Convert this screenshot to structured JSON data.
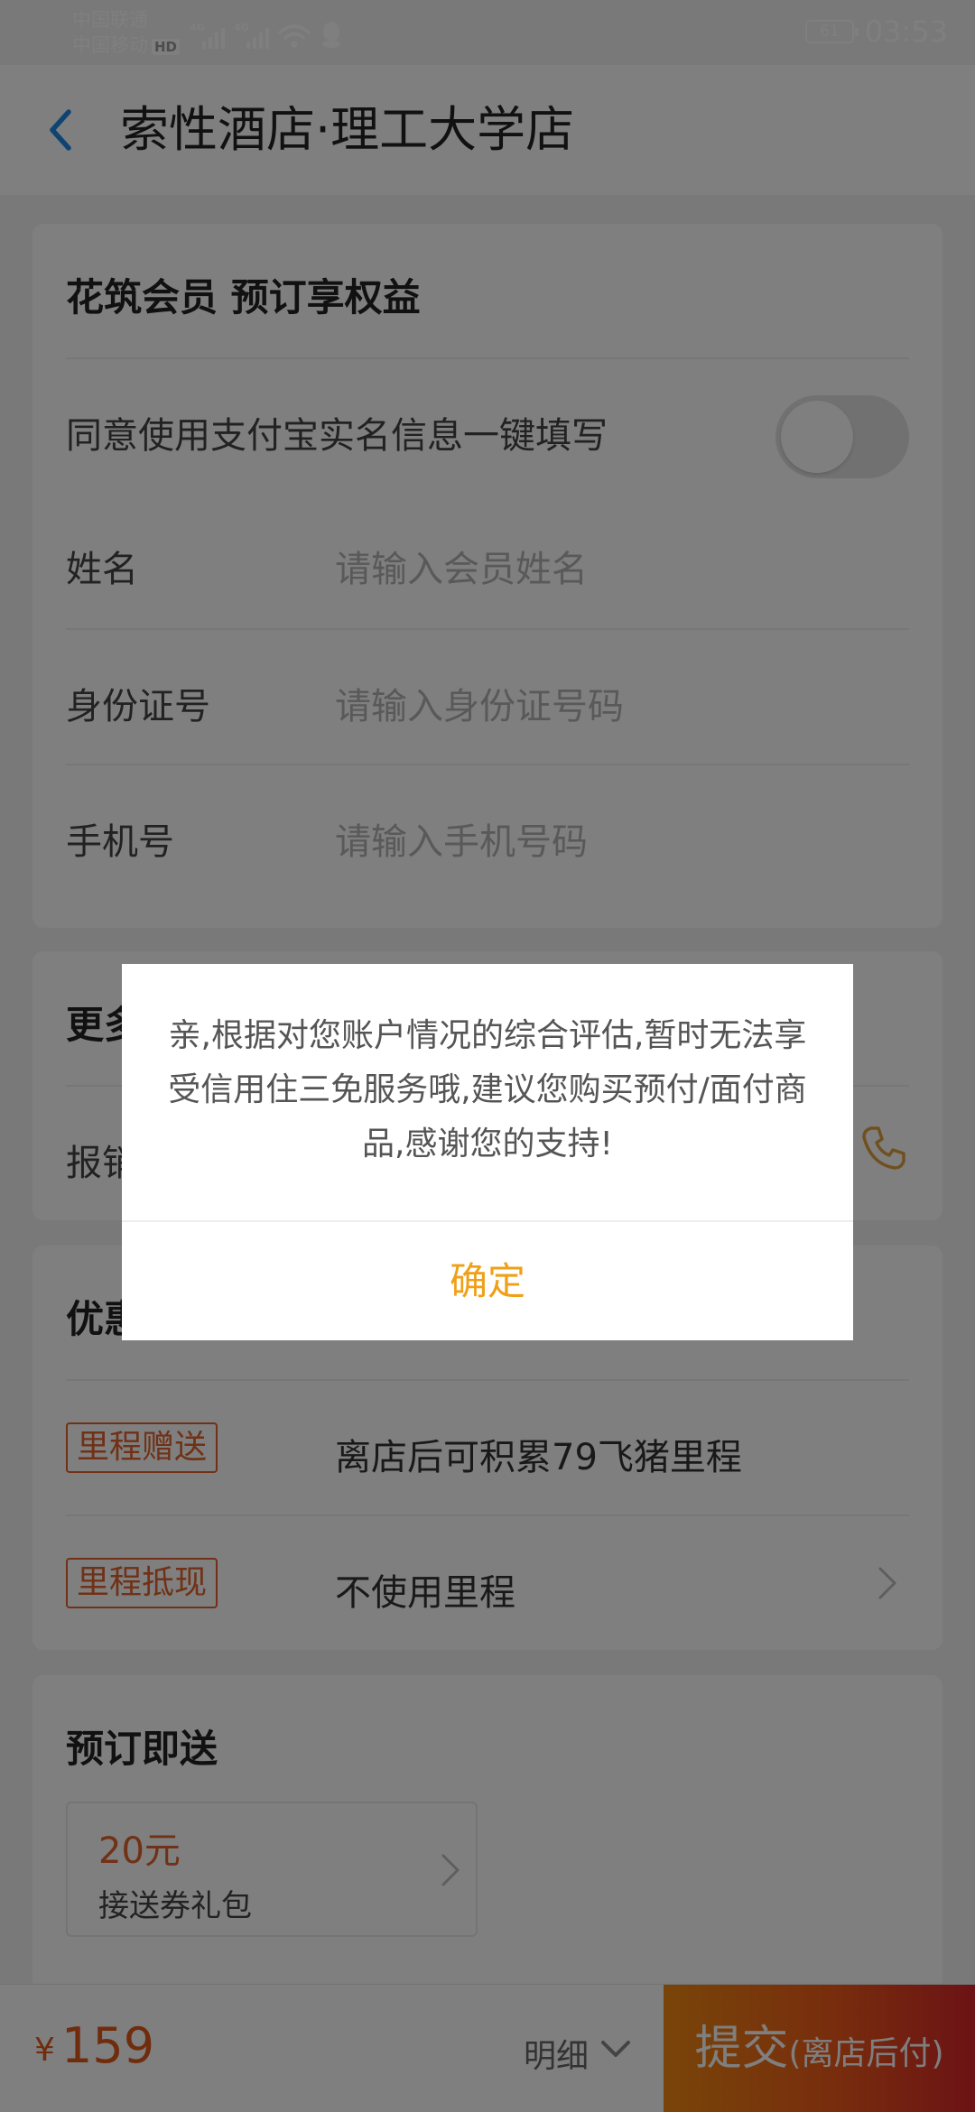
{
  "status_bar": {
    "carrier_1": "中国联通",
    "carrier_2": "中国移动",
    "hd_badge": "HD",
    "signal_1_label": "4G",
    "signal_2_label": "4G",
    "battery": "61",
    "time": "03:53"
  },
  "header": {
    "title": "索性酒店·理工大学店",
    "back_icon": "chevron-left-icon"
  },
  "member_section": {
    "title": "花筑会员 预订享权益",
    "alipay_toggle_label": "同意使用支付宝实名信息一键填写",
    "alipay_toggle_on": false,
    "name_label": "姓名",
    "name_placeholder": "请输入会员姓名",
    "id_label": "身份证号",
    "id_placeholder": "请输入身份证号码",
    "phone_label": "手机号",
    "phone_placeholder": "请输入手机号码"
  },
  "more_section": {
    "title": "更多",
    "reimburse_label": "报销"
  },
  "discount_section": {
    "title": "优惠",
    "mileage_tag": "里程赠送",
    "mileage_text": "离店后可积累79飞猪里程",
    "redeem_tag": "里程抵现",
    "redeem_text": "不使用里程"
  },
  "gift_section": {
    "title": "预订即送",
    "gift_price": "20元",
    "gift_name": "接送券礼包"
  },
  "bottom_bar": {
    "currency": "¥",
    "price": "159",
    "detail_label": "明细",
    "submit_label": "提交",
    "submit_sub": "(离店后付)"
  },
  "dialog": {
    "message": "亲,根据对您账户情况的综合评估,暂时无法享受信用住三免服务哦,建议您购买预付/面付商品,感谢您的支持!",
    "confirm_label": "确定"
  },
  "colors": {
    "accent_orange": "#e0632c",
    "confirm_yellow": "#f0a017",
    "back_blue": "#1e88e5"
  }
}
